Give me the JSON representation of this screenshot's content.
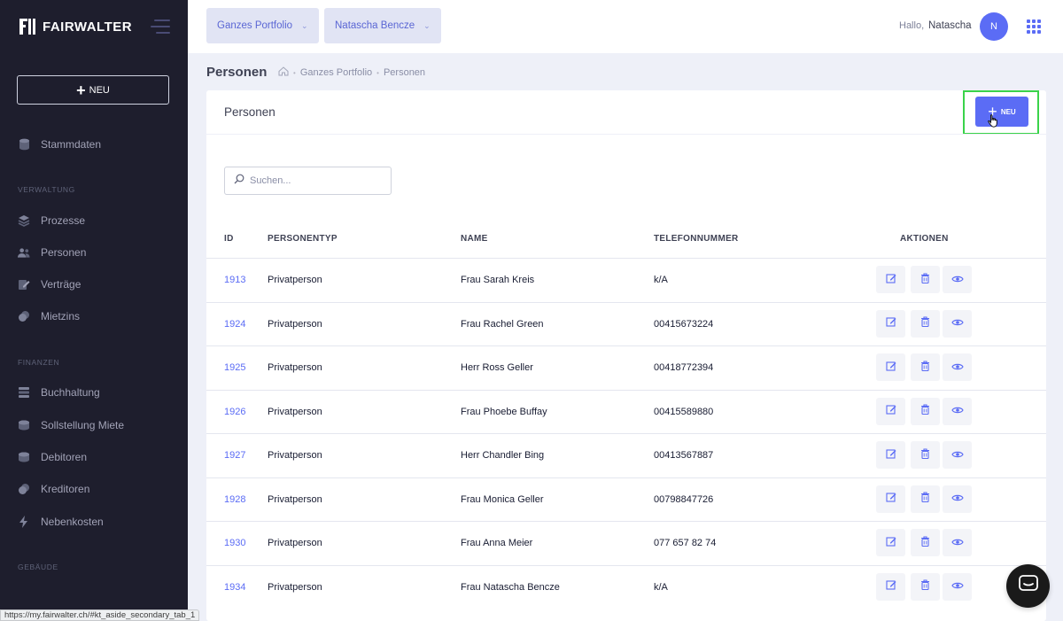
{
  "brand": {
    "name": "FAIRWALTER"
  },
  "sidebar": {
    "new_label": "NEU",
    "items": [
      {
        "label": "Stammdaten",
        "icon": "database-icon"
      },
      {
        "section": "VERWALTUNG"
      },
      {
        "label": "Prozesse",
        "icon": "layers-icon"
      },
      {
        "label": "Personen",
        "icon": "users-icon"
      },
      {
        "label": "Verträge",
        "icon": "edit-document-icon"
      },
      {
        "label": "Mietzins",
        "icon": "coins-icon"
      },
      {
        "section": "FINANZEN"
      },
      {
        "label": "Buchhaltung",
        "icon": "stack-icon"
      },
      {
        "label": "Sollstellung Miete",
        "icon": "coins-icon"
      },
      {
        "label": "Debitoren",
        "icon": "coins-icon"
      },
      {
        "label": "Kreditoren",
        "icon": "coins-icon"
      },
      {
        "label": "Nebenkosten",
        "icon": "flash-icon"
      },
      {
        "section": "GEBÄUDE"
      }
    ]
  },
  "header": {
    "portfolio_label": "Ganzes Portfolio",
    "user_select_label": "Natascha Bencze",
    "greeting": "Hallo,",
    "user_name": "Natascha",
    "avatar_initial": "N"
  },
  "subheader": {
    "title": "Personen",
    "breadcrumbs": [
      "Ganzes Portfolio",
      "Personen"
    ]
  },
  "card": {
    "title": "Personen",
    "new_button_label": "NEU",
    "search_placeholder": "Suchen...",
    "columns": {
      "id": "ID",
      "typ": "PERSONENTYP",
      "name": "NAME",
      "tel": "TELEFONNUMMER",
      "actions": "AKTIONEN"
    },
    "rows": [
      {
        "id": "1913",
        "typ": "Privatperson",
        "name": "Frau Sarah Kreis",
        "tel": "k/A"
      },
      {
        "id": "1924",
        "typ": "Privatperson",
        "name": "Frau Rachel Green",
        "tel": "00415673224"
      },
      {
        "id": "1925",
        "typ": "Privatperson",
        "name": "Herr Ross Geller",
        "tel": "00418772394"
      },
      {
        "id": "1926",
        "typ": "Privatperson",
        "name": "Frau Phoebe Buffay",
        "tel": "00415589880"
      },
      {
        "id": "1927",
        "typ": "Privatperson",
        "name": "Herr Chandler Bing",
        "tel": "00413567887"
      },
      {
        "id": "1928",
        "typ": "Privatperson",
        "name": "Frau Monica Geller",
        "tel": "00798847726"
      },
      {
        "id": "1930",
        "typ": "Privatperson",
        "name": "Frau Anna Meier",
        "tel": "077 657 82 74"
      },
      {
        "id": "1934",
        "typ": "Privatperson",
        "name": "Frau Natascha Bencze",
        "tel": "k/A"
      }
    ]
  },
  "statusbar": {
    "url": "https://my.fairwalter.ch/#kt_aside_secondary_tab_1"
  },
  "colors": {
    "accent": "#5b6cf5",
    "sidebar_bg": "#1e1e2d",
    "highlight": "#3ad34a"
  }
}
